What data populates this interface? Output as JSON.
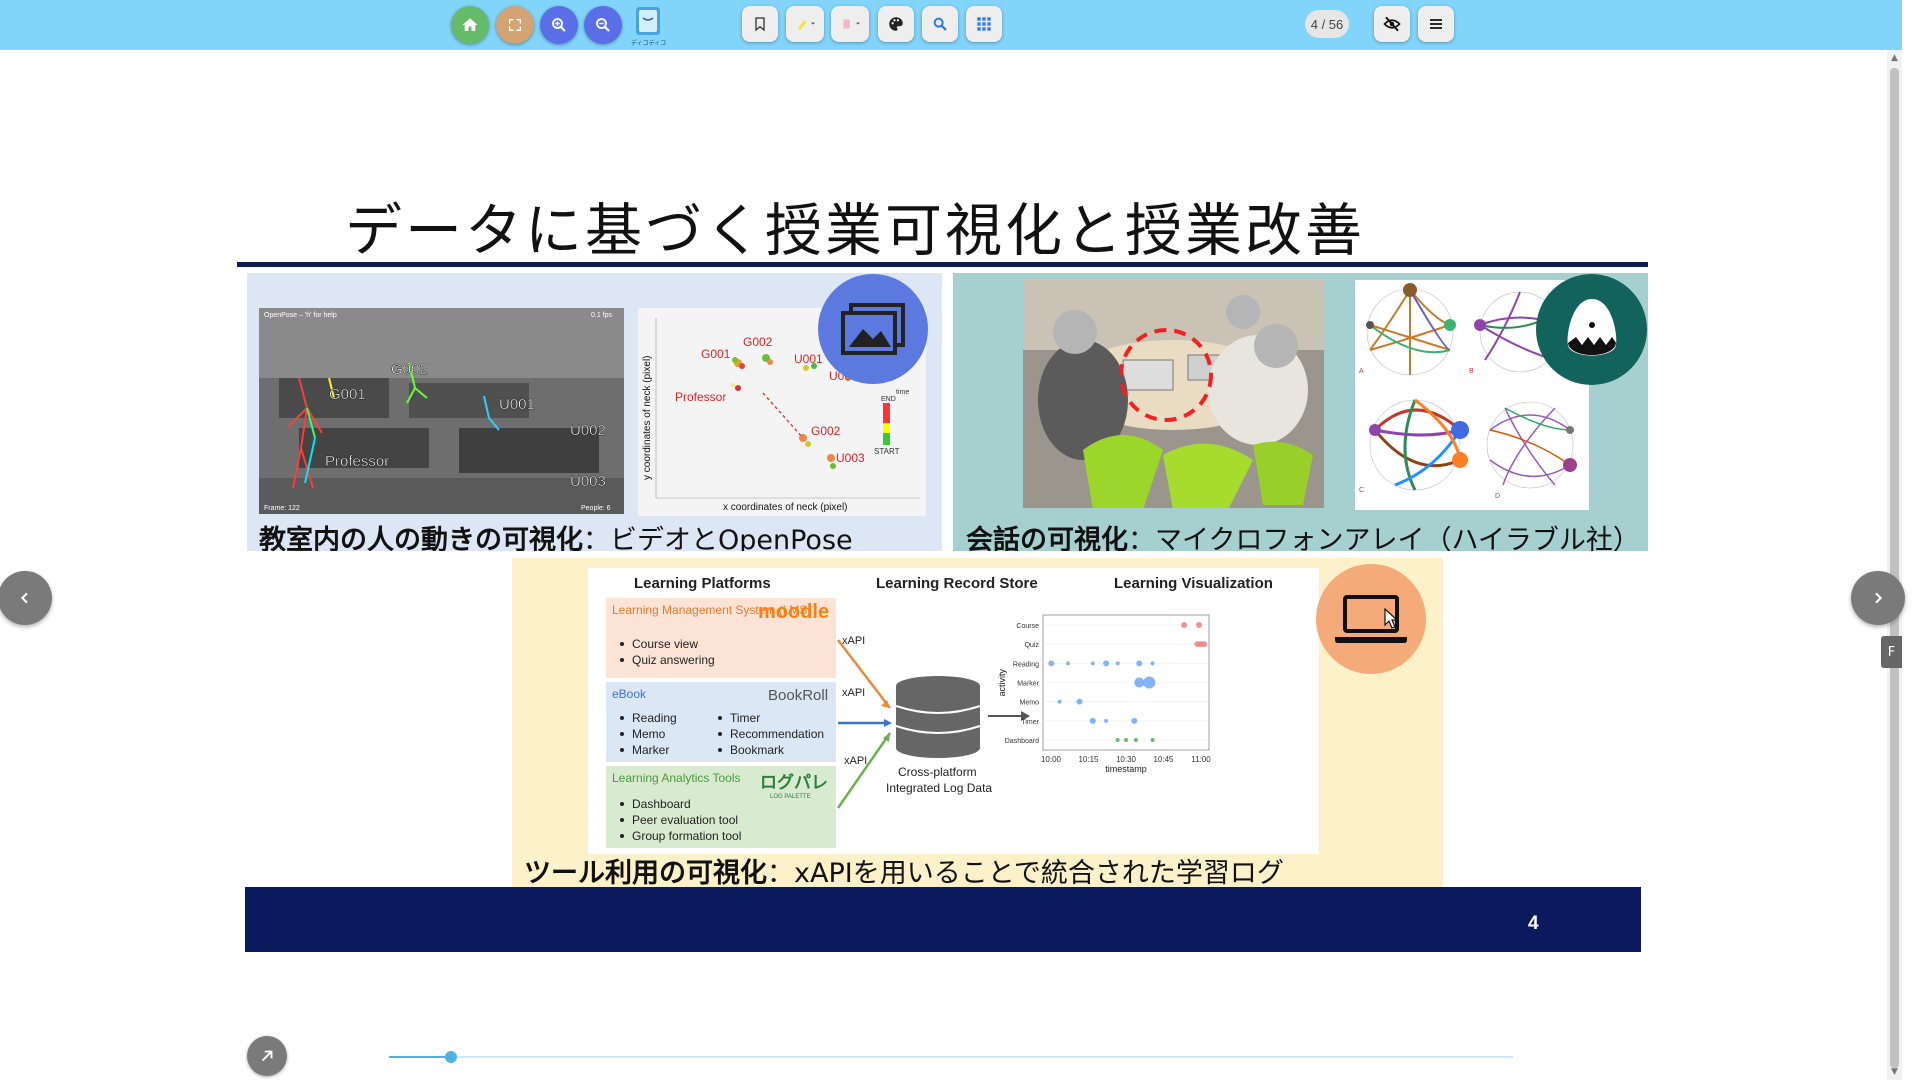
{
  "toolbar": {
    "buttons": [
      {
        "name": "home-button",
        "icon": "home-icon",
        "color": "#66bb6a"
      },
      {
        "name": "fullscreen-button",
        "icon": "fullscreen-icon",
        "color": "#d4a373"
      },
      {
        "name": "zoom-in-button",
        "icon": "zoom-in-icon",
        "color": "#5a6ee8"
      },
      {
        "name": "zoom-out-button",
        "icon": "zoom-out-icon",
        "color": "#5a6ee8"
      }
    ],
    "logo_text": "ディコディコ",
    "tools": [
      "bookmark-icon",
      "highlighter-icon",
      "eraser-icon",
      "palette-icon",
      "search-icon",
      "grid-icon"
    ],
    "page_counter": "4 / 56",
    "right_tools": [
      "eye-off-icon",
      "menu-icon"
    ]
  },
  "slide": {
    "title": "データに基づく授業可視化と授業改善",
    "page_number": "4",
    "panel1": {
      "caption_bold": "教室内の人の動きの可視化",
      "caption_rest": "：ビデオとOpenPose",
      "video_header_left": "OpenPose – 'h' for help",
      "video_header_right": "0.1 fps",
      "video_footer_left": "Frame: 122",
      "video_footer_right": "People: 6",
      "labels": [
        "G002",
        "G001",
        "U001",
        "U002",
        "Professor",
        "U003"
      ],
      "plot_labels": [
        "G002",
        "G001",
        "U001",
        "U002",
        "Professor",
        "G002",
        "U003"
      ],
      "plot_xlabel": "x coordinates of neck (pixel)",
      "plot_ylabel": "y coordinates of neck (pixel)",
      "plot_legend_time": "time",
      "plot_legend_end": "END",
      "plot_legend_start": "START",
      "badge_icon": "image-gallery-icon"
    },
    "panel2": {
      "caption_bold": "会話の可視化",
      "caption_rest": "：マイクロフォンアレイ（ハイラブル社）",
      "graph_labels": [
        "A",
        "B",
        "C",
        "D"
      ],
      "badge_icon": "egg-icon"
    },
    "panel3": {
      "caption_bold": "ツール利用の可視化",
      "caption_rest": "：xAPIを用いることで統合された学習ログ",
      "header_platforms": "Learning  Platforms",
      "header_lrs": "Learning Record Store",
      "header_vis": "Learning Visualization",
      "lms_title": "Learning Management System (LMS)",
      "lms_logo": "moodle",
      "lms_items": [
        "Course view",
        "Quiz answering"
      ],
      "ebook_title": "eBook",
      "ebook_logo": "BookRoll",
      "ebook_items_left": [
        "Reading",
        "Memo",
        "Marker"
      ],
      "ebook_items_right": [
        "Timer",
        "Recommendation",
        "Bookmark"
      ],
      "la_title": "Learning Analytics Tools",
      "la_logo": "ログパレ",
      "la_logo_sub": "LOG PALETTE",
      "la_items": [
        "Dashboard",
        "Peer evaluation tool",
        "Group formation tool"
      ],
      "xapi": [
        "xAPI",
        "xAPI",
        "xAPI"
      ],
      "db_label_1": "Cross-platform",
      "db_label_2": "Integrated Log Data",
      "vis_ylabel": "activity",
      "vis_xlabel": "timestamp",
      "vis_categories": [
        "Course",
        "Quiz",
        "Reading",
        "Marker",
        "Memo",
        "Timer",
        "Dashboard"
      ],
      "vis_ticks": [
        "10:00",
        "10:15",
        "10:30",
        "10:45",
        "11:00"
      ],
      "badge_icon": "laptop-icon"
    }
  },
  "navigation": {
    "prev_icon": "chevron-left-icon",
    "next_icon": "chevron-right-icon",
    "share_icon": "arrow-up-right-icon",
    "edge_tab": "F",
    "slider_progress": 0.055
  }
}
